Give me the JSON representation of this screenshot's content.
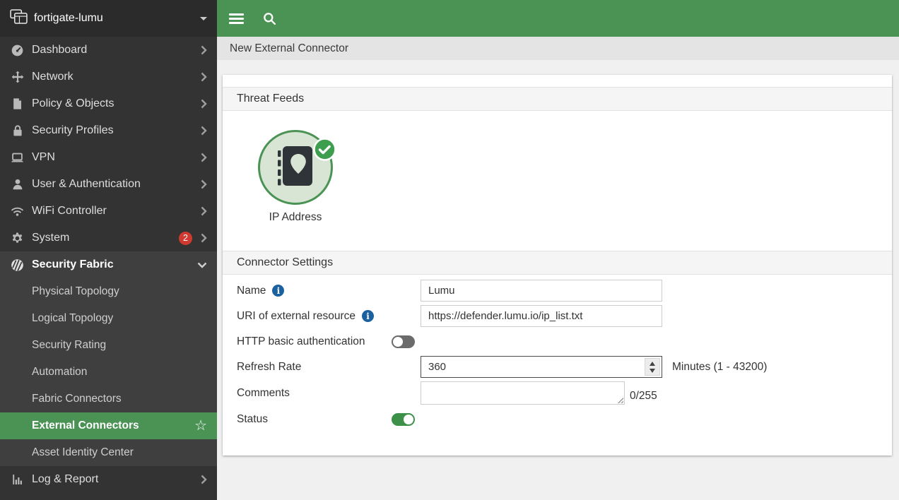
{
  "app": {
    "hostname": "fortigate-lumu"
  },
  "breadcrumb": {
    "title": "New External Connector"
  },
  "sidebar": {
    "items": [
      {
        "label": "Dashboard"
      },
      {
        "label": "Network"
      },
      {
        "label": "Policy & Objects"
      },
      {
        "label": "Security Profiles"
      },
      {
        "label": "VPN"
      },
      {
        "label": "User & Authentication"
      },
      {
        "label": "WiFi Controller"
      },
      {
        "label": "System",
        "badge": "2"
      },
      {
        "label": "Security Fabric"
      },
      {
        "label": "Physical Topology"
      },
      {
        "label": "Logical Topology"
      },
      {
        "label": "Security Rating"
      },
      {
        "label": "Automation"
      },
      {
        "label": "Fabric Connectors"
      },
      {
        "label": "External Connectors"
      },
      {
        "label": "Asset Identity Center"
      },
      {
        "label": "Log & Report"
      }
    ]
  },
  "sections": {
    "threat_feeds": "Threat Feeds",
    "connector_settings": "Connector Settings"
  },
  "feed_tile": {
    "label": "IP Address",
    "selected": true
  },
  "form": {
    "name": {
      "label": "Name",
      "value": "Lumu"
    },
    "uri": {
      "label": "URI of external resource",
      "value": "https://defender.lumu.io/ip_list.txt"
    },
    "http_auth": {
      "label": "HTTP basic authentication",
      "state": "off"
    },
    "refresh": {
      "label": "Refresh Rate",
      "value": "360",
      "suffix": "Minutes (1 - 43200)"
    },
    "comments": {
      "label": "Comments",
      "value": "",
      "counter": "0/255"
    },
    "status": {
      "label": "Status",
      "state": "on"
    }
  },
  "glyphs": {
    "star": "☆"
  },
  "icons": {
    "window-stack-icon": "svg",
    "caret-down-icon": "css-triangle",
    "gauge-icon": "svg",
    "move-icon": "svg",
    "policy-icon": "svg",
    "lock-icon": "svg",
    "laptop-icon": "svg",
    "user-icon": "svg",
    "wifi-icon": "svg",
    "gear-icon": "svg",
    "fabric-icon": "svg",
    "chart-icon": "svg",
    "chevron-right-icon": "svg",
    "chevron-down-icon": "svg",
    "star-icon": "☆",
    "menu-icon": "bars",
    "search-icon": "svg",
    "info-icon": "i",
    "check-badge-icon": "svg",
    "address-book-icon": "svg",
    "pin-icon": "svg",
    "stepper-up-icon": "triangle",
    "stepper-down-icon": "triangle",
    "resize-grip-icon": "lines"
  },
  "colors": {
    "accent_green": "#4a9355",
    "sidebar_bg": "#333333",
    "sidebar_expanded_bg": "#3f3f3f",
    "badge_red": "#cf3a30",
    "info_blue": "#1c619f",
    "toggle_off_gray": "#6b6b6b",
    "toggle_on_green": "#3d9048",
    "tile_fill": "#d8e5d5"
  }
}
